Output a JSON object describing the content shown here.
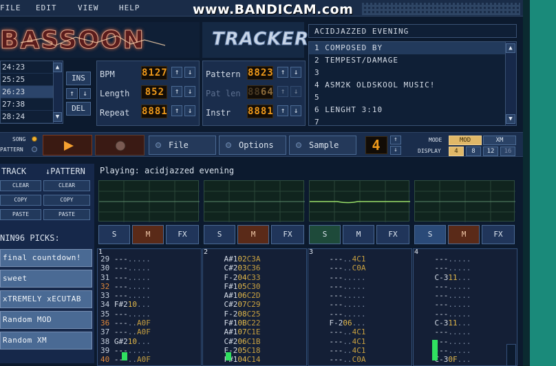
{
  "menu": [
    "FILE",
    "EDIT",
    "VIEW",
    "HELP"
  ],
  "watermark": "www.BANDICAM.com",
  "logo": "BASSOON",
  "tracker_logo": "TRACKER",
  "song_title": "ACIDJAZZED EVENING",
  "info_rows": [
    "1 COMPOSED BY",
    "2 TEMPEST/DAMAGE",
    "3",
    "4 ASM2K OLDSKOOL MUSIC!",
    "5",
    "6 LENGHT 3:10",
    "7"
  ],
  "positions": [
    {
      "label": "24:23",
      "selected": false
    },
    {
      "label": "25:25",
      "selected": false
    },
    {
      "label": "26:23",
      "selected": true
    },
    {
      "label": "27:38",
      "selected": false
    },
    {
      "label": "28:24",
      "selected": false
    }
  ],
  "pos_buttons": {
    "ins": "INS",
    "del": "DEL",
    "up": "↑",
    "down": "↓"
  },
  "song_params": {
    "bpm_label": "BPM",
    "bpm": "127",
    "bpm_ghost": "8",
    "length_label": "Length",
    "length": "52",
    "length_ghost": "8",
    "repeat_label": "Repeat",
    "repeat": "1",
    "repeat_ghost": "888"
  },
  "pattern_params": {
    "pattern_label": "Pattern",
    "pattern": "23",
    "pattern_ghost": "88",
    "patlen_label": "Pat len",
    "patlen": "64",
    "patlen_ghost": "88",
    "instr_label": "Instr",
    "instr": "1",
    "instr_ghost": "888"
  },
  "transport": {
    "song_label": "SONG",
    "pattern_label": "PATTERN",
    "file": "File",
    "options": "Options",
    "sample": "Sample",
    "octave": "4"
  },
  "mode": {
    "label": "MODE",
    "mod": "MOD",
    "xm": "XM",
    "display_label": "DISPLAY",
    "display": [
      "4",
      "8",
      "12",
      "16"
    ],
    "display_selected": "4"
  },
  "side": {
    "track": "TRACK",
    "pattern": "↓PATTERN",
    "clear": "CLEAR",
    "copy": "COPY",
    "paste": "PASTE",
    "picks_title": "NIN96 PICKS:",
    "picks": [
      "final countdown!",
      "sweet",
      "xTREMELY xECUTAB",
      "Random MOD",
      "Random XM"
    ]
  },
  "playing": "Playing: acidjazzed evening",
  "channel_buttons": [
    {
      "s": "S",
      "m": "M",
      "fx": "FX",
      "state": "m"
    },
    {
      "s": "S",
      "m": "M",
      "fx": "FX",
      "state": "m"
    },
    {
      "s": "S",
      "m": "M",
      "fx": "FX",
      "state": "s"
    },
    {
      "s": "S",
      "m": "M",
      "fx": "FX",
      "state": "m"
    }
  ],
  "tracks": [
    {
      "num": "1",
      "rows": [
        {
          "n": "29",
          "note": "---",
          "ins": "..",
          "fx": "...",
          "o": false
        },
        {
          "n": "30",
          "note": "---",
          "ins": "..",
          "fx": "...",
          "o": false
        },
        {
          "n": "31",
          "note": "---",
          "ins": "..",
          "fx": "...",
          "o": false
        },
        {
          "n": "32",
          "note": "---",
          "ins": "..",
          "fx": "...",
          "o": true
        },
        {
          "n": "33",
          "note": "---",
          "ins": "..",
          "fx": "...",
          "o": false
        },
        {
          "n": "34",
          "note": "F#2",
          "ins": "10",
          "fx": "...",
          "o": false
        },
        {
          "n": "35",
          "note": "---",
          "ins": "..",
          "fx": "...",
          "o": false
        },
        {
          "n": "36",
          "note": "---",
          "ins": "..",
          "fx": "A0F",
          "o": true
        },
        {
          "n": "37",
          "note": "---",
          "ins": "..",
          "fx": "A0F",
          "o": false
        },
        {
          "n": "38",
          "note": "G#2",
          "ins": "10",
          "fx": "...",
          "o": false
        },
        {
          "n": "39",
          "note": "---",
          "ins": "..",
          "fx": "...",
          "o": false
        },
        {
          "n": "40",
          "note": "---",
          "ins": "..",
          "fx": "A0F",
          "o": true
        }
      ]
    },
    {
      "num": "2",
      "rows": [
        {
          "note": "A#1",
          "ins": "02",
          "fx": "C3A"
        },
        {
          "note": "C#2",
          "ins": "03",
          "fx": "C36"
        },
        {
          "note": "F-2",
          "ins": "04",
          "fx": "C33"
        },
        {
          "note": "F#1",
          "ins": "05",
          "fx": "C30"
        },
        {
          "note": "A#1",
          "ins": "06",
          "fx": "C2D"
        },
        {
          "note": "C#2",
          "ins": "07",
          "fx": "C29"
        },
        {
          "note": "F-2",
          "ins": "08",
          "fx": "C25"
        },
        {
          "note": "F#1",
          "ins": "0B",
          "fx": "C22"
        },
        {
          "note": "A#1",
          "ins": "07",
          "fx": "C1E"
        },
        {
          "note": "C#2",
          "ins": "06",
          "fx": "C1B"
        },
        {
          "note": "F-2",
          "ins": "05",
          "fx": "C18"
        },
        {
          "note": "F#1",
          "ins": "04",
          "fx": "C14"
        }
      ]
    },
    {
      "num": "3",
      "rows": [
        {
          "note": "---",
          "ins": "..",
          "fx": "4C1"
        },
        {
          "note": "---",
          "ins": "..",
          "fx": "C0A"
        },
        {
          "note": "---",
          "ins": "..",
          "fx": "..."
        },
        {
          "note": "---",
          "ins": "..",
          "fx": "..."
        },
        {
          "note": "---",
          "ins": "..",
          "fx": "..."
        },
        {
          "note": "---",
          "ins": "..",
          "fx": "..."
        },
        {
          "note": "---",
          "ins": "..",
          "fx": "..."
        },
        {
          "note": "F-2",
          "ins": "06",
          "fx": "..."
        },
        {
          "note": "---",
          "ins": "..",
          "fx": "4C1"
        },
        {
          "note": "---",
          "ins": "..",
          "fx": "4C1"
        },
        {
          "note": "---",
          "ins": "..",
          "fx": "4C1"
        },
        {
          "note": "---",
          "ins": "..",
          "fx": "C0A"
        }
      ]
    },
    {
      "num": "4",
      "rows": [
        {
          "note": "---",
          "ins": "..",
          "fx": "..."
        },
        {
          "note": "---",
          "ins": "..",
          "fx": "..."
        },
        {
          "note": "C-3",
          "ins": "11",
          "fx": "..."
        },
        {
          "note": "---",
          "ins": "..",
          "fx": "..."
        },
        {
          "note": "---",
          "ins": "..",
          "fx": "..."
        },
        {
          "note": "---",
          "ins": "..",
          "fx": "..."
        },
        {
          "note": "---",
          "ins": "..",
          "fx": "..."
        },
        {
          "note": "C-3",
          "ins": "11",
          "fx": "..."
        },
        {
          "note": "---",
          "ins": "..",
          "fx": "..."
        },
        {
          "note": "---",
          "ins": "..",
          "fx": "..."
        },
        {
          "note": "---",
          "ins": "..",
          "fx": "..."
        },
        {
          "note": "C-3",
          "ins": "0F",
          "fx": "..."
        }
      ]
    }
  ],
  "vu_levels": [
    0.1,
    0.1,
    0,
    0.25
  ]
}
